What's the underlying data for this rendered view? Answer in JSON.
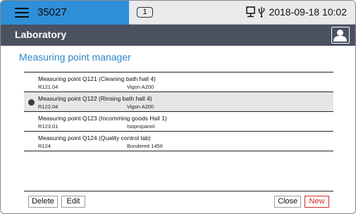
{
  "statusbar": {
    "device_id": "35027",
    "counter": "1",
    "datetime": "2018-09-18 10:02",
    "icons": [
      "menu-icon",
      "network-icon",
      "usb-icon"
    ]
  },
  "header": {
    "title": "Laboratory",
    "user_icon": "user-icon"
  },
  "main": {
    "heading": "Measuring point manager",
    "rows": [
      {
        "name": "Measuring point Q121 (Cleaning bath hall 4)",
        "code": "R121.04",
        "medium": "Vigon A200",
        "selected": false
      },
      {
        "name": "Measuring point Q122 (Rinsing bath hall 4)",
        "code": "R122.04",
        "medium": "Vigon A200",
        "selected": true
      },
      {
        "name": "Measuring point Q123 (Incomming goods Hall 1)",
        "code": "R123.01",
        "medium": "Isopropanol",
        "selected": false
      },
      {
        "name": "Measuring point Q124 (Quality control lab)",
        "code": "R124",
        "medium": "Bondereit 1456",
        "selected": false
      }
    ]
  },
  "footer": {
    "delete_label": "Delete",
    "edit_label": "Edit",
    "close_label": "Close",
    "new_label": "New"
  },
  "colors": {
    "accent_blue": "#2f8fd8",
    "heading_blue": "#2c86c8",
    "titlebar": "#4a5160",
    "new_red": "#d12a2a"
  }
}
